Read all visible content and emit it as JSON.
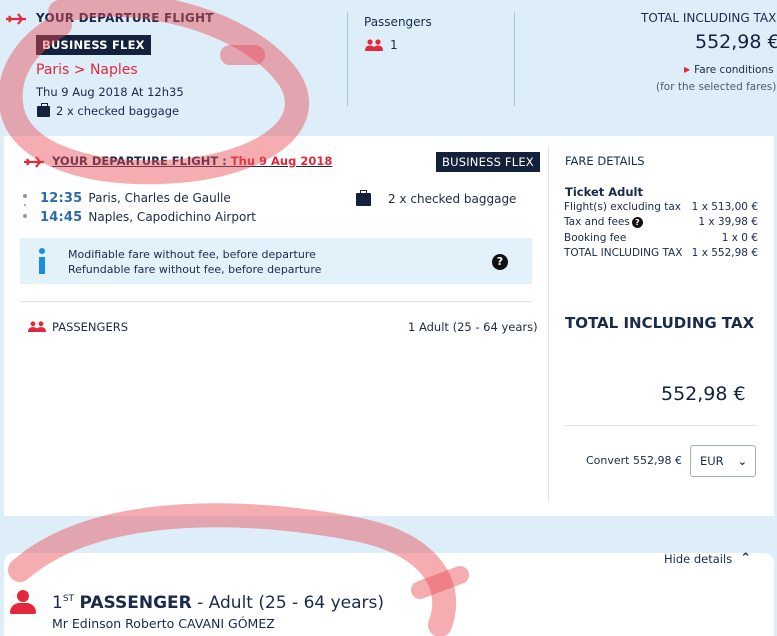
{
  "summary": {
    "title": "YOUR DEPARTURE FLIGHT",
    "fare_badge": "BUSINESS FLEX",
    "route": "Paris > Naples",
    "datetime": "Thu 9 Aug 2018 At 12h35",
    "baggage": "2 x checked baggage",
    "passengers_label": "Passengers",
    "passengers_count": "1",
    "total_label": "TOTAL INCLUDING TAX",
    "total_value": "552,98 €",
    "fare_conditions": "Fare conditions",
    "fare_selected": "(for the selected fares)"
  },
  "flight": {
    "title_prefix": "YOUR DEPARTURE FLIGHT : ",
    "title_date": "Thu 9 Aug 2018",
    "fare_badge": "BUSINESS FLEX",
    "dep_time": "12:35",
    "dep_place": "Paris, Charles de Gaulle",
    "arr_time": "14:45",
    "arr_place": "Naples, Capodichino Airport",
    "baggage": "2 x checked baggage",
    "info_line1": "Modifiable fare without fee, before departure",
    "info_line2": "Refundable fare without fee, before departure",
    "help": "?",
    "passengers_label": "PASSENGERS",
    "passengers_value": "1 Adult (25 - 64 years)"
  },
  "fare_details": {
    "title": "FARE DETAILS",
    "ticket": "Ticket Adult",
    "rows": [
      {
        "label": "Flight(s) excluding tax",
        "value": "1 x 513,00 €"
      },
      {
        "label": "Tax and fees",
        "value": "1 x 39,98 €"
      },
      {
        "label": "Booking fee",
        "value": "1 x 0 €"
      },
      {
        "label": "TOTAL INCLUDING TAX",
        "value": "1 x 552,98 €"
      }
    ],
    "total_label": "TOTAL INCLUDING TAX",
    "total_value": "552,98 €",
    "convert_label": "Convert 552,98 €",
    "currency": "EUR"
  },
  "passenger_section": {
    "hide_details": "Hide details",
    "ordinal_num": "1",
    "ordinal_suffix": "ST",
    "passenger_word": "PASSENGER",
    "passenger_type": " - Adult (25 - 64 years)",
    "name": "Mr  Edinson Roberto  CAVANI GÓMEZ"
  },
  "colors": {
    "accent_red": "#e2283a",
    "navy": "#14213d",
    "time_blue": "#2d6aa8",
    "info_blue": "#1d8be0",
    "background": "#ddeef9"
  }
}
